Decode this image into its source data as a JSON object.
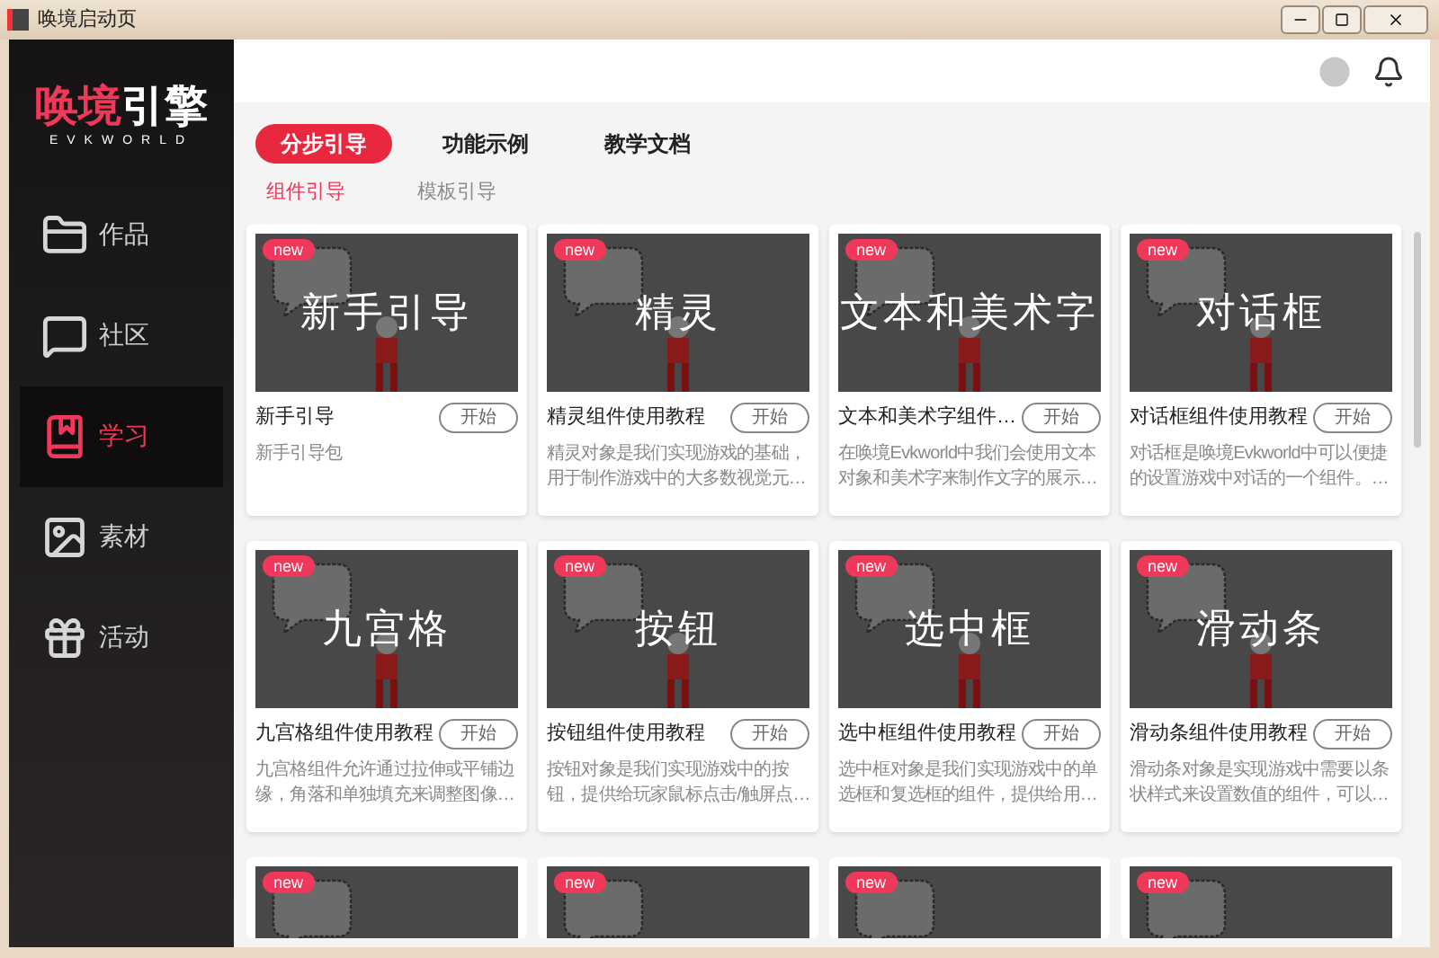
{
  "window": {
    "title": "唤境启动页"
  },
  "logo": {
    "name": "唤境",
    "name_accent": "引擎",
    "subtitle": "EVKWORLD"
  },
  "sidebar": {
    "items": [
      {
        "label": "作品",
        "selected": false
      },
      {
        "label": "社区",
        "selected": false
      },
      {
        "label": "学习",
        "selected": true
      },
      {
        "label": "素材",
        "selected": false
      },
      {
        "label": "活动",
        "selected": false
      }
    ]
  },
  "tabs": [
    {
      "label": "分步引导",
      "selected": true
    },
    {
      "label": "功能示例",
      "selected": false
    },
    {
      "label": "教学文档",
      "selected": false
    }
  ],
  "subtabs": [
    {
      "label": "组件引导",
      "selected": true
    },
    {
      "label": "模板引导",
      "selected": false
    }
  ],
  "cards": [
    {
      "badge": "new",
      "thumb_text": "新手引导",
      "title": "新手引导",
      "button": "开始",
      "description": [
        "新手引导包"
      ]
    },
    {
      "badge": "new",
      "thumb_text": "精灵",
      "title": "精灵组件使用教程",
      "button": "开始",
      "description": [
        "精灵对象是我们实现游戏的基础，",
        "用于制作游戏中的大多数视觉元…"
      ]
    },
    {
      "badge": "new",
      "thumb_text": "文本和美术字",
      "title": "文本和美术字组件…",
      "button": "开始",
      "description": [
        "在唤境Evkworld中我们会使用文本",
        "对象和美术字来制作文字的展示…"
      ]
    },
    {
      "badge": "new",
      "thumb_text": "对话框",
      "title": "对话框组件使用教程",
      "button": "开始",
      "description": [
        "对话框是唤境Evkworld中可以便捷",
        "的设置游戏中对话的一个组件。…"
      ]
    },
    {
      "badge": "new",
      "thumb_text": "九宫格",
      "title": "九宫格组件使用教程",
      "button": "开始",
      "description": [
        "九宫格组件允许通过拉伸或平铺边",
        "缘，角落和单独填充来调整图像…"
      ]
    },
    {
      "badge": "new",
      "thumb_text": "按钮",
      "title": "按钮组件使用教程",
      "button": "开始",
      "description": [
        "按钮对象是我们实现游戏中的按",
        "钮，提供给玩家鼠标点击/触屏点…"
      ]
    },
    {
      "badge": "new",
      "thumb_text": "选中框",
      "title": "选中框组件使用教程",
      "button": "开始",
      "description": [
        "选中框对象是我们实现游戏中的单",
        "选框和复选框的组件，提供给用…"
      ]
    },
    {
      "badge": "new",
      "thumb_text": "滑动条",
      "title": "滑动条组件使用教程",
      "button": "开始",
      "description": [
        "滑动条对象是实现游戏中需要以条",
        "状样式来设置数值的组件，可以…"
      ]
    }
  ],
  "partial_cards": [
    {
      "badge": "new"
    },
    {
      "badge": "new"
    },
    {
      "badge": "new"
    },
    {
      "badge": "new"
    }
  ]
}
